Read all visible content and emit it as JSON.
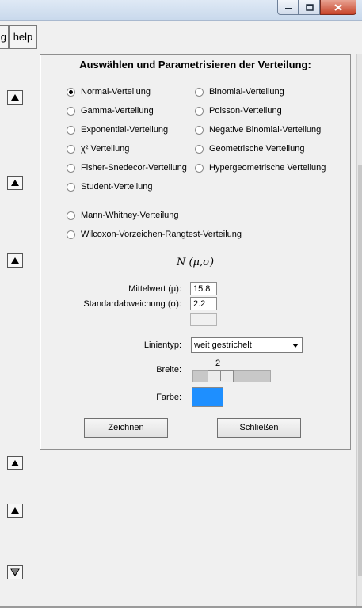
{
  "menu": {
    "left_fragment": "g",
    "help": "help"
  },
  "dialog": {
    "title": "Auswählen und Parametrisieren der Verteilung:",
    "distributions_left": [
      {
        "label": "Normal-Verteilung",
        "selected": true
      },
      {
        "label": "Gamma-Verteilung",
        "selected": false
      },
      {
        "label": "Exponential-Verteilung",
        "selected": false
      },
      {
        "label": "χ² Verteilung",
        "selected": false
      },
      {
        "label": "Fisher-Snedecor-Verteilung",
        "selected": false
      },
      {
        "label": "Student-Verteilung",
        "selected": false
      }
    ],
    "distributions_right": [
      {
        "label": "Binomial-Verteilung",
        "selected": false
      },
      {
        "label": "Poisson-Verteilung",
        "selected": false
      },
      {
        "label": "Negative Binomial-Verteilung",
        "selected": false
      },
      {
        "label": "Geometrische Verteilung",
        "selected": false
      },
      {
        "label": "Hypergeometrische Verteilung",
        "selected": false
      }
    ],
    "distributions_extra": [
      {
        "label": "Mann-Whitney-Verteilung",
        "selected": false
      },
      {
        "label": "Wilcoxon-Vorzeichen-Rangtest-Verteilung",
        "selected": false
      }
    ],
    "formula": "N (μ,σ)",
    "params": [
      {
        "label": "Mittelwert (μ):",
        "value": "15.8"
      },
      {
        "label": "Standardabweichung (σ):",
        "value": "2.2"
      }
    ],
    "linientyp": {
      "label": "Linientyp:",
      "value": "weit gestrichelt"
    },
    "breite": {
      "label": "Breite:",
      "value": "2"
    },
    "farbe": {
      "label": "Farbe:",
      "color": "#1e8fff"
    },
    "buttons": {
      "draw": "Zeichnen",
      "close": "Schließen"
    }
  },
  "colors": {
    "accent_swatch": "#1e8fff",
    "close_button": "#c7442a"
  }
}
